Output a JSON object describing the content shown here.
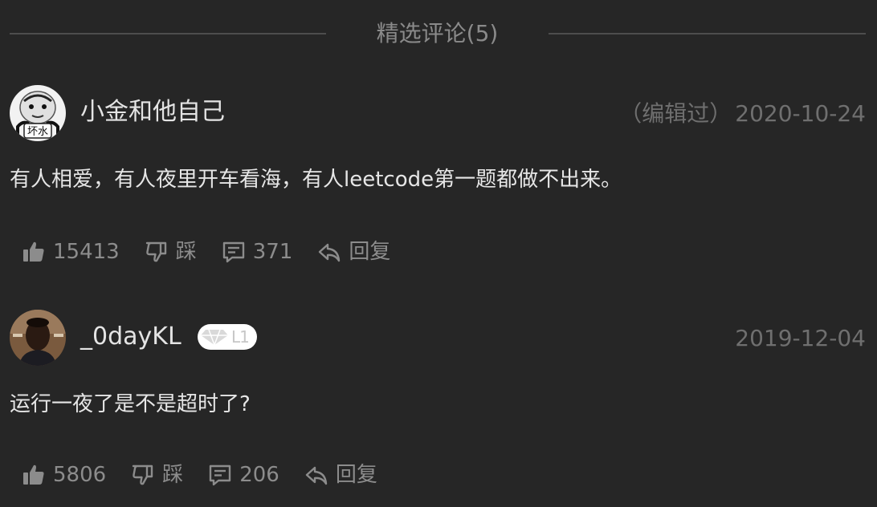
{
  "section": {
    "title": "精选评论(5)"
  },
  "comments": [
    {
      "username": "小金和他自己",
      "edited": "（编辑过）",
      "date": "2020-10-24",
      "content": "有人相爱，有人夜里开车看海，有人leetcode第一题都做不出来。",
      "avatar_text": "坏水",
      "likes": "15413",
      "dislike_label": "踩",
      "replies": "371",
      "reply_label": "回复"
    },
    {
      "username": "_0dayKL",
      "level": "L1",
      "date": "2019-12-04",
      "content": "运行一夜了是不是超时了?",
      "likes": "5806",
      "dislike_label": "踩",
      "replies": "206",
      "reply_label": "回复"
    }
  ],
  "icons": {
    "like": "thumbs-up-icon",
    "dislike": "thumbs-down-icon",
    "comment": "comment-icon",
    "reply": "reply-icon",
    "level": "diamond-icon"
  },
  "colors": {
    "background": "#262626",
    "text_primary": "#e6e6e6",
    "text_secondary": "#8c8c8c",
    "text_muted": "#6f6f6f",
    "divider": "#4d4d4d"
  }
}
